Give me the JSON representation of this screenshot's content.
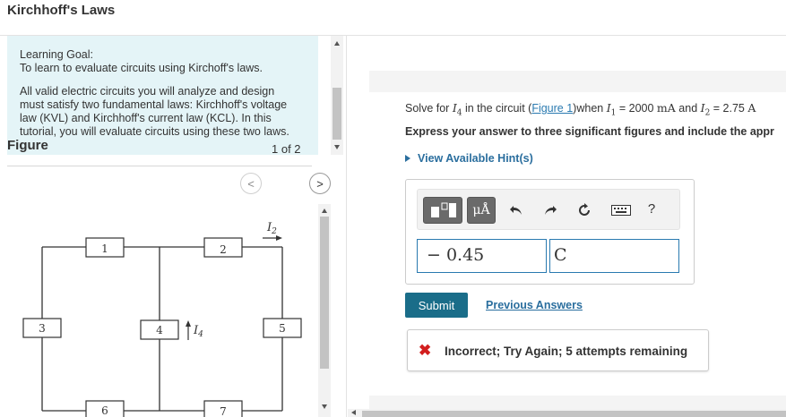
{
  "page": {
    "title": "Kirchhoff's Laws"
  },
  "learning_goal": {
    "title": "Learning Goal:",
    "text": "To learn to evaluate circuits using Kirchoff's laws.",
    "body_lines": [
      "All valid electric circuits you will analyze and design",
      "must satisfy two fundamental laws: Kirchhoff's voltage",
      "law (KVL) and Kirchhoff's current law (KCL). In this",
      "tutorial, you will evaluate circuits using these two laws."
    ]
  },
  "figure": {
    "label": "Figure",
    "pager_text": "1 of 2",
    "prev_glyph": "<",
    "next_glyph": ">",
    "circuit_labels": {
      "box1": "1",
      "box2": "2",
      "box3": "3",
      "box4": "4",
      "box5": "5",
      "box6": "6",
      "box7": "7",
      "current_i2": "I",
      "current_i2_sub": "2",
      "current_i4": "I",
      "current_i4_sub": "4"
    }
  },
  "question": {
    "pre": "Solve for ",
    "var_main": "I",
    "var_sub": "4",
    "mid1": " in the circuit (",
    "figure_link": "Figure 1",
    "mid2": ")when ",
    "i1_main": "I",
    "i1_sub": "1",
    "i1_value": " = 2000 ",
    "i1_unit": "mA",
    "and": " and ",
    "i2_main": "I",
    "i2_sub": "2",
    "i2_value": " = 2.75 ",
    "i2_unit": "A",
    "express": "Express your answer to three significant figures and include the appr"
  },
  "hint": {
    "label": "View Available Hint(s)"
  },
  "toolbar": {
    "units_label": "μÅ",
    "help_label": "?"
  },
  "answer": {
    "value": "− 0.45",
    "unit": "C"
  },
  "actions": {
    "submit_label": "Submit",
    "previous_answers_label": "Previous Answers"
  },
  "feedback": {
    "icon": "✖",
    "text": "Incorrect; Try Again; 5 attempts remaining",
    "color": "#d21e1e"
  },
  "colors": {
    "accent": "#2a7ab0",
    "submit": "#1a6d89",
    "goal_background": "#e4f4f7"
  }
}
